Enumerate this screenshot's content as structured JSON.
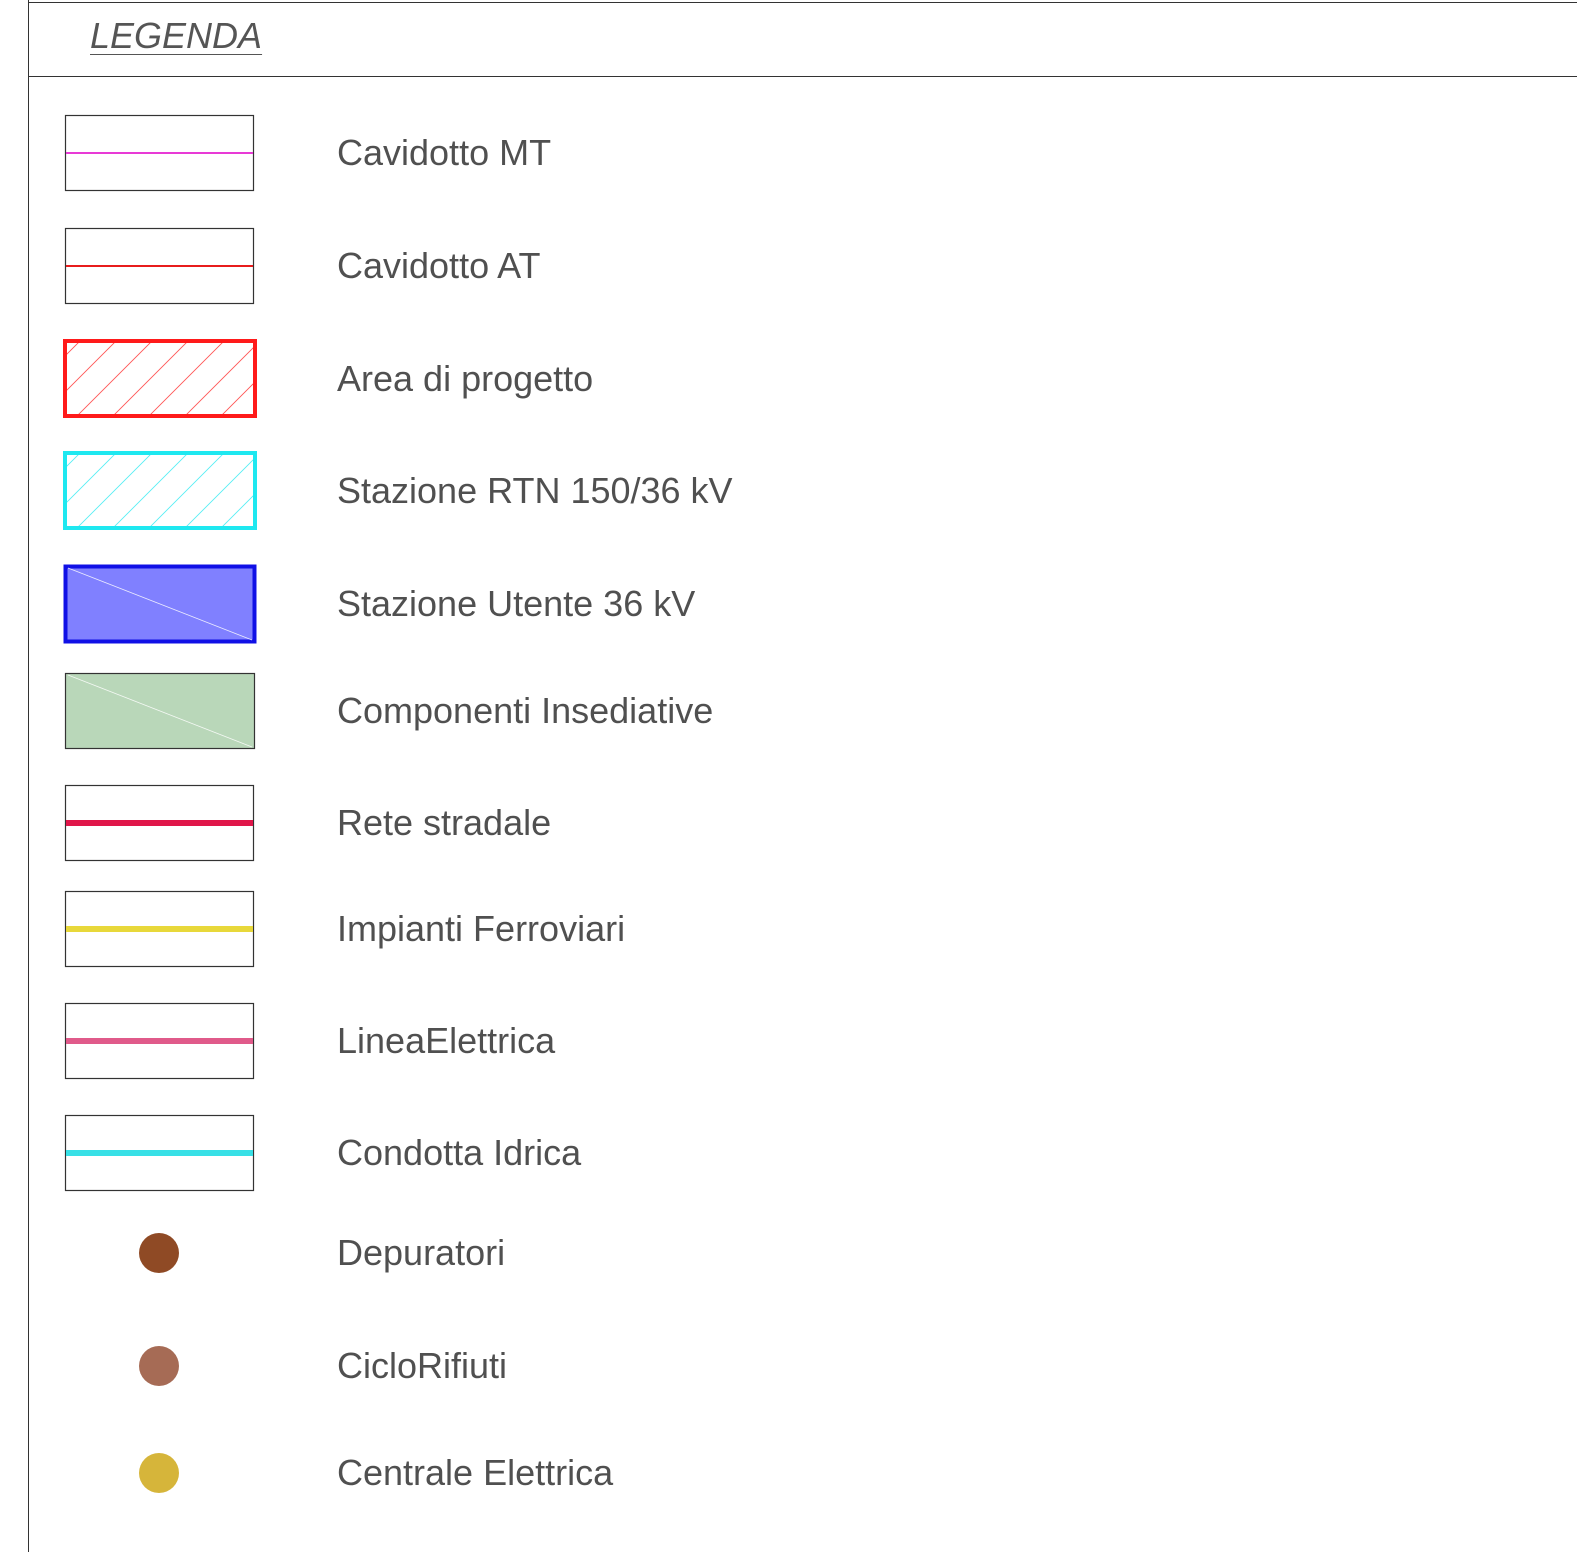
{
  "legend": {
    "title": "LEGENDA",
    "items": [
      {
        "label": "Cavidotto MT",
        "symbol": "line",
        "color": "#e83ad6",
        "width": 2
      },
      {
        "label": "Cavidotto AT",
        "symbol": "line",
        "color": "#e81c1c",
        "width": 2
      },
      {
        "label": "Area di progetto",
        "symbol": "hatched-box",
        "color": "#ff1a1a"
      },
      {
        "label": "Stazione RTN 150/36 kV",
        "symbol": "hatched-box",
        "color": "#1ee8f0"
      },
      {
        "label": "Stazione Utente 36 kV",
        "symbol": "filled-box",
        "color": "#1010e6",
        "fill": "#8080ff"
      },
      {
        "label": "Componenti Insediative",
        "symbol": "filled-box",
        "color": "#333333",
        "fill": "#b9d7b9"
      },
      {
        "label": "Rete stradale",
        "symbol": "line",
        "color": "#e0164a",
        "width": 6
      },
      {
        "label": "Impianti Ferroviari",
        "symbol": "line",
        "color": "#e8d83a",
        "width": 6
      },
      {
        "label": "LineaElettrica",
        "symbol": "line",
        "color": "#e05a8a",
        "width": 6
      },
      {
        "label": "Condotta Idrica",
        "symbol": "line",
        "color": "#38e0e6",
        "width": 6
      },
      {
        "label": "Depuratori",
        "symbol": "dot",
        "color": "#8f4a25"
      },
      {
        "label": "CicloRifiuti",
        "symbol": "dot",
        "color": "#a66b55"
      },
      {
        "label": "Centrale Elettrica",
        "symbol": "dot",
        "color": "#d6b53a"
      }
    ]
  }
}
